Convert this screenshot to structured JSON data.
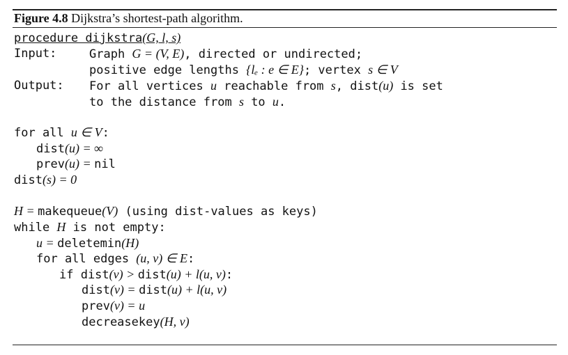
{
  "figure": {
    "label": "Figure 4.8",
    "title": "Dijkstra’s shortest-path algorithm."
  },
  "header": {
    "signature_kw": "procedure dijkstra",
    "signature_args": "(G, l, s)",
    "input_label": "Input:",
    "input_line1_a": "Graph ",
    "input_line1_math": "G = (V, E)",
    "input_line1_b": ", directed or undirected;",
    "input_line2_a": "positive edge lengths ",
    "input_line2_math": "{lₑ : e ∈ E}",
    "input_line2_b": "; vertex ",
    "input_line2_math2": "s ∈ V",
    "output_label": "Output:",
    "output_line1_a": "For all vertices ",
    "output_line1_u": "u",
    "output_line1_b": " reachable from ",
    "output_line1_s": "s",
    "output_line1_c": ", dist",
    "output_line1_paren": "(u)",
    "output_line1_d": " is set",
    "output_line2_a": "to the distance from ",
    "output_line2_s": "s",
    "output_line2_b": " to ",
    "output_line2_u": "u",
    "output_line2_c": "."
  },
  "init": {
    "forall_kw": "for all ",
    "forall_math": "u ∈ V",
    "forall_colon": ":",
    "dist_kw": "dist",
    "dist_math": "(u) = ∞",
    "prev_kw": "prev",
    "prev_math": "(u) = ",
    "prev_val": "nil",
    "dists_kw": "dist",
    "dists_math": "(s) = 0"
  },
  "main": {
    "h_math": "H = ",
    "makequeue": "makequeue",
    "makequeue_arg": "(V)",
    "makequeue_comment": "  (using dist-values as keys)",
    "while_kw": "while ",
    "while_math": "H",
    "while_rest": " is not empty:",
    "u_math": "u = ",
    "deletemin": "deletemin",
    "deletemin_arg": "(H)",
    "foredges_kw": "for all edges ",
    "foredges_math": "(u, v) ∈ E",
    "foredges_colon": ":",
    "if_kw": "if dist",
    "if_math1": "(v) > ",
    "if_dist2": "dist",
    "if_math2": "(u) + l(u, v)",
    "if_colon": ":",
    "upd_dist": "dist",
    "upd_math1": "(v) = ",
    "upd_dist2": "dist",
    "upd_math2": "(u) + l(u, v)",
    "upd_prev": "prev",
    "upd_prev_math": "(v) = u",
    "decreasekey": "decreasekey",
    "decreasekey_arg": "(H, v)"
  }
}
